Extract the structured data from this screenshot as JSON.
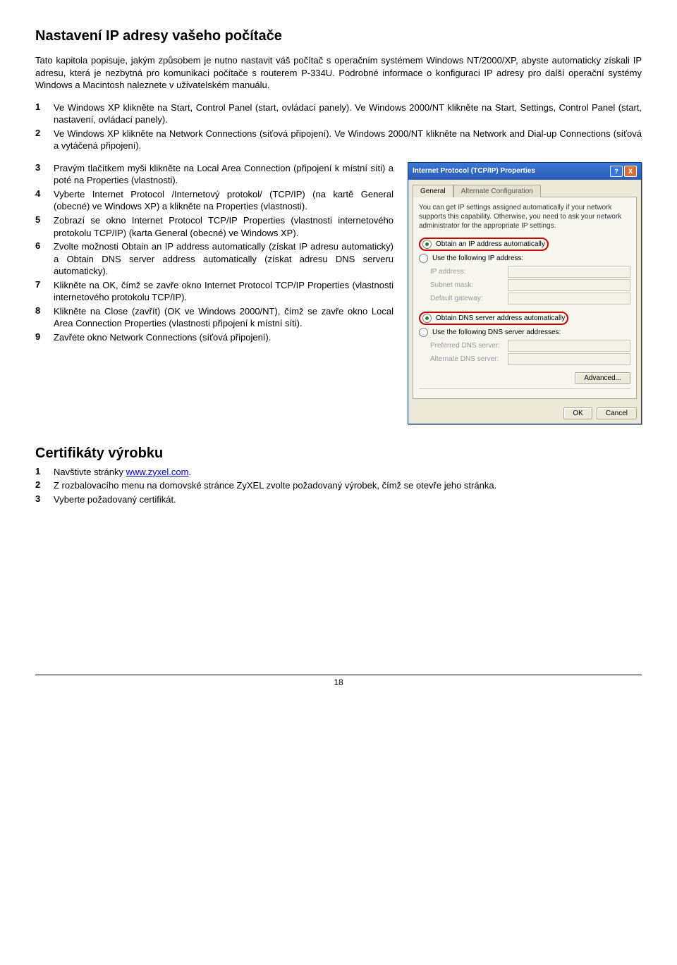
{
  "h1": "Nastavení IP adresy vašeho počítače",
  "intro": "Tato kapitola popisuje, jakým způsobem je nutno nastavit váš počítač s operačním systémem Windows NT/2000/XP, abyste automaticky získali IP adresu, která je nezbytná pro komunikaci počítače s routerem P-334U. Podrobné informace o konfiguraci IP adresy pro další operační systémy Windows a Macintosh naleznete v uživatelském manuálu.",
  "listA": {
    "i1": "Ve Windows XP klikněte na Start, Control Panel (start, ovládací panely). Ve Windows 2000/NT klikněte na Start, Settings, Control Panel (start, nastavení, ovládací panely).",
    "i2": "Ve Windows XP klikněte na Network Connections (síťová připojení). Ve Windows 2000/NT klikněte na Network and Dial-up Connections (síťová a vytáčená připojení)."
  },
  "listB": {
    "i3": "Pravým tlačítkem myši klikněte na Local Area Connection (připojení k místní síti) a poté na Properties (vlastnosti).",
    "i4": "Vyberte Internet Protocol /Internetový protokol/ (TCP/IP) (na kartě General (obecné) ve Windows XP) a klikněte na Properties (vlastnosti).",
    "i5": "Zobrazí se okno Internet Protocol TCP/IP Properties (vlastnosti internetového protokolu TCP/IP) (karta General (obecné) ve Windows XP).",
    "i6": "Zvolte možnosti Obtain an IP address automatically (získat IP adresu automaticky) a Obtain DNS server address automatically (získat adresu DNS serveru automaticky).",
    "i7": "Klikněte na OK, čímž se zavře okno Internet Protocol TCP/IP Properties (vlastnosti internetového protokolu TCP/IP).",
    "i8": "Klikněte na Close (zavřít) (OK ve Windows 2000/NT), čímž se zavře okno Local Area Connection Properties (vlastnosti připojení k místní síti).",
    "i9": "Zavřete okno Network Connections (síťová připojení)."
  },
  "h2": "Certifikáty výrobku",
  "listC": {
    "i1a": "Navštivte stránky ",
    "i1link": "www.zyxel.com",
    "i1b": ".",
    "i2": "Z rozbalovacího menu na domovské stránce ZyXEL zvolte požadovaný výrobek, čímž se otevře jeho stránka.",
    "i3": "Vyberte požadovaný certifikát."
  },
  "dialog": {
    "title": "Internet Protocol (TCP/IP) Properties",
    "tab1": "General",
    "tab2": "Alternate Configuration",
    "desc": "You can get IP settings assigned automatically if your network supports this capability. Otherwise, you need to ask your network administrator for the appropriate IP settings.",
    "r1": "Obtain an IP address automatically",
    "r2": "Use the following IP address:",
    "f_ip": "IP address:",
    "f_mask": "Subnet mask:",
    "f_gw": "Default gateway:",
    "r3": "Obtain DNS server address automatically",
    "r4": "Use the following DNS server addresses:",
    "f_dns1": "Preferred DNS server:",
    "f_dns2": "Alternate DNS server:",
    "adv": "Advanced...",
    "ok": "OK",
    "cancel": "Cancel"
  },
  "pageNumber": "18"
}
